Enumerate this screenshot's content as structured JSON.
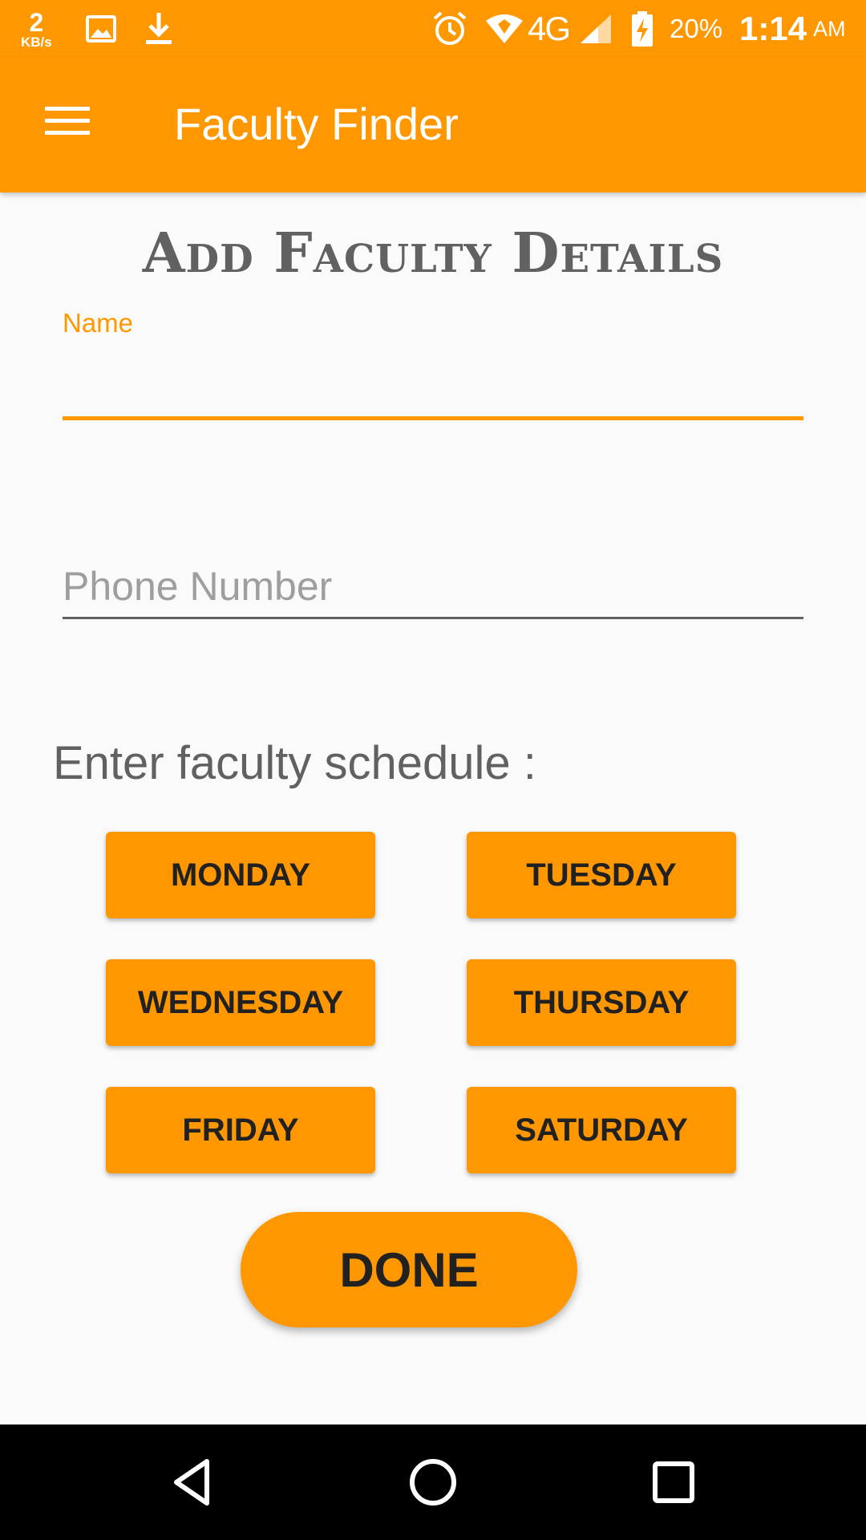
{
  "status_bar": {
    "net_speed_value": "2",
    "net_speed_unit": "KB/s",
    "network": "4G",
    "battery": "20%",
    "time": "1:14",
    "ampm": "AM",
    "icons": [
      "image-icon",
      "download-icon",
      "alarm-icon",
      "wifi-icon",
      "signal-icon",
      "battery-charging-icon"
    ]
  },
  "toolbar": {
    "title": "Faculty Finder",
    "menu_icon": "hamburger-menu-icon"
  },
  "form": {
    "heading": "Add Faculty Details",
    "name_label": "Name",
    "name_value": "",
    "phone_placeholder": "Phone Number",
    "phone_value": "",
    "schedule_label": "Enter faculty schedule :",
    "days": {
      "monday": "MONDAY",
      "tuesday": "TUESDAY",
      "wednesday": "WEDNESDAY",
      "thursday": "THURSDAY",
      "friday": "FRIDAY",
      "saturday": "SATURDAY"
    },
    "done_label": "DONE"
  },
  "nav_bar": {
    "icons": [
      "back-icon",
      "home-icon",
      "recents-icon"
    ]
  },
  "colors": {
    "accent": "#ff9800",
    "heading_text": "#616161",
    "button_text": "#212121",
    "background": "#fafafa"
  }
}
